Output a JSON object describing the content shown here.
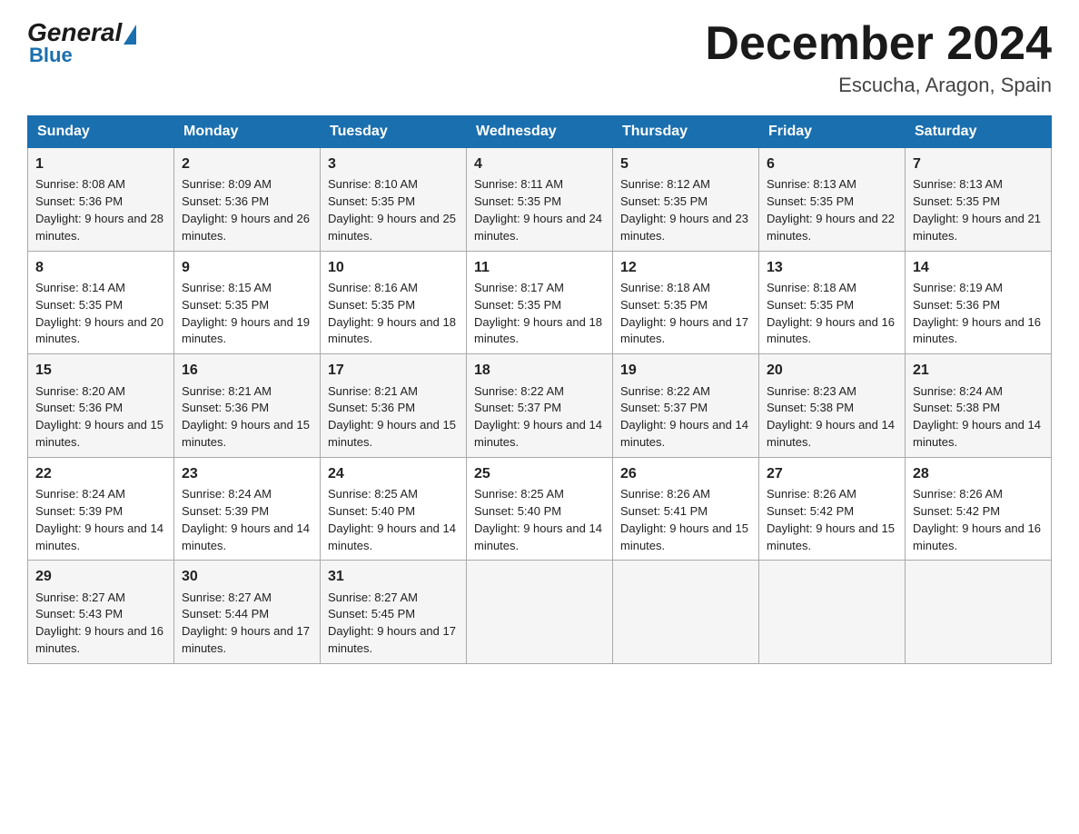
{
  "header": {
    "logo_general": "General",
    "logo_blue": "Blue",
    "month_title": "December 2024",
    "location": "Escucha, Aragon, Spain"
  },
  "weekdays": [
    "Sunday",
    "Monday",
    "Tuesday",
    "Wednesday",
    "Thursday",
    "Friday",
    "Saturday"
  ],
  "weeks": [
    [
      {
        "day": "1",
        "sunrise": "8:08 AM",
        "sunset": "5:36 PM",
        "daylight": "9 hours and 28 minutes."
      },
      {
        "day": "2",
        "sunrise": "8:09 AM",
        "sunset": "5:36 PM",
        "daylight": "9 hours and 26 minutes."
      },
      {
        "day": "3",
        "sunrise": "8:10 AM",
        "sunset": "5:35 PM",
        "daylight": "9 hours and 25 minutes."
      },
      {
        "day": "4",
        "sunrise": "8:11 AM",
        "sunset": "5:35 PM",
        "daylight": "9 hours and 24 minutes."
      },
      {
        "day": "5",
        "sunrise": "8:12 AM",
        "sunset": "5:35 PM",
        "daylight": "9 hours and 23 minutes."
      },
      {
        "day": "6",
        "sunrise": "8:13 AM",
        "sunset": "5:35 PM",
        "daylight": "9 hours and 22 minutes."
      },
      {
        "day": "7",
        "sunrise": "8:13 AM",
        "sunset": "5:35 PM",
        "daylight": "9 hours and 21 minutes."
      }
    ],
    [
      {
        "day": "8",
        "sunrise": "8:14 AM",
        "sunset": "5:35 PM",
        "daylight": "9 hours and 20 minutes."
      },
      {
        "day": "9",
        "sunrise": "8:15 AM",
        "sunset": "5:35 PM",
        "daylight": "9 hours and 19 minutes."
      },
      {
        "day": "10",
        "sunrise": "8:16 AM",
        "sunset": "5:35 PM",
        "daylight": "9 hours and 18 minutes."
      },
      {
        "day": "11",
        "sunrise": "8:17 AM",
        "sunset": "5:35 PM",
        "daylight": "9 hours and 18 minutes."
      },
      {
        "day": "12",
        "sunrise": "8:18 AM",
        "sunset": "5:35 PM",
        "daylight": "9 hours and 17 minutes."
      },
      {
        "day": "13",
        "sunrise": "8:18 AM",
        "sunset": "5:35 PM",
        "daylight": "9 hours and 16 minutes."
      },
      {
        "day": "14",
        "sunrise": "8:19 AM",
        "sunset": "5:36 PM",
        "daylight": "9 hours and 16 minutes."
      }
    ],
    [
      {
        "day": "15",
        "sunrise": "8:20 AM",
        "sunset": "5:36 PM",
        "daylight": "9 hours and 15 minutes."
      },
      {
        "day": "16",
        "sunrise": "8:21 AM",
        "sunset": "5:36 PM",
        "daylight": "9 hours and 15 minutes."
      },
      {
        "day": "17",
        "sunrise": "8:21 AM",
        "sunset": "5:36 PM",
        "daylight": "9 hours and 15 minutes."
      },
      {
        "day": "18",
        "sunrise": "8:22 AM",
        "sunset": "5:37 PM",
        "daylight": "9 hours and 14 minutes."
      },
      {
        "day": "19",
        "sunrise": "8:22 AM",
        "sunset": "5:37 PM",
        "daylight": "9 hours and 14 minutes."
      },
      {
        "day": "20",
        "sunrise": "8:23 AM",
        "sunset": "5:38 PM",
        "daylight": "9 hours and 14 minutes."
      },
      {
        "day": "21",
        "sunrise": "8:24 AM",
        "sunset": "5:38 PM",
        "daylight": "9 hours and 14 minutes."
      }
    ],
    [
      {
        "day": "22",
        "sunrise": "8:24 AM",
        "sunset": "5:39 PM",
        "daylight": "9 hours and 14 minutes."
      },
      {
        "day": "23",
        "sunrise": "8:24 AM",
        "sunset": "5:39 PM",
        "daylight": "9 hours and 14 minutes."
      },
      {
        "day": "24",
        "sunrise": "8:25 AM",
        "sunset": "5:40 PM",
        "daylight": "9 hours and 14 minutes."
      },
      {
        "day": "25",
        "sunrise": "8:25 AM",
        "sunset": "5:40 PM",
        "daylight": "9 hours and 14 minutes."
      },
      {
        "day": "26",
        "sunrise": "8:26 AM",
        "sunset": "5:41 PM",
        "daylight": "9 hours and 15 minutes."
      },
      {
        "day": "27",
        "sunrise": "8:26 AM",
        "sunset": "5:42 PM",
        "daylight": "9 hours and 15 minutes."
      },
      {
        "day": "28",
        "sunrise": "8:26 AM",
        "sunset": "5:42 PM",
        "daylight": "9 hours and 16 minutes."
      }
    ],
    [
      {
        "day": "29",
        "sunrise": "8:27 AM",
        "sunset": "5:43 PM",
        "daylight": "9 hours and 16 minutes."
      },
      {
        "day": "30",
        "sunrise": "8:27 AM",
        "sunset": "5:44 PM",
        "daylight": "9 hours and 17 minutes."
      },
      {
        "day": "31",
        "sunrise": "8:27 AM",
        "sunset": "5:45 PM",
        "daylight": "9 hours and 17 minutes."
      },
      null,
      null,
      null,
      null
    ]
  ]
}
